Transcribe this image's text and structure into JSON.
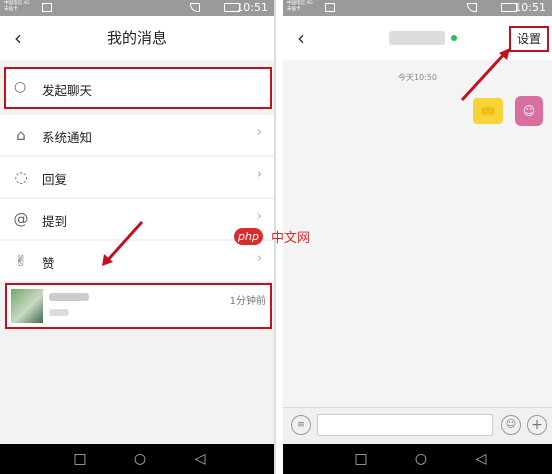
{
  "left_screen": {
    "status": {
      "carrier": "中国电信 4G\n未插卡",
      "time": "10:51"
    },
    "header": {
      "back_icon": "back-chevron-icon",
      "title": "我的消息"
    },
    "start_chat": {
      "icon": "chat-bubble-icon",
      "label": "发起聊天"
    },
    "menu_items": [
      {
        "icon": "bell-icon",
        "label": "系统通知"
      },
      {
        "icon": "comment-icon",
        "label": "回复"
      },
      {
        "icon": "at-icon",
        "label": "提到"
      },
      {
        "icon": "thumbs-up-icon",
        "label": "赞"
      }
    ],
    "contact": {
      "time": "1分钟前"
    },
    "nav": {
      "square": "□",
      "circle": "○",
      "back": "◁"
    }
  },
  "right_screen": {
    "status": {
      "carrier": "中国电信 4G\n未插卡",
      "time": "10:51"
    },
    "header": {
      "back_icon": "back-chevron-icon",
      "settings_label": "设置"
    },
    "timestamp": "今天10:50",
    "input": {
      "voice_icon": "voice-icon",
      "emoji_icon": "emoji-icon",
      "plus_icon": "plus-icon"
    },
    "nav": {
      "square": "□",
      "circle": "○",
      "back": "◁"
    }
  },
  "watermark": {
    "logo": "php",
    "text": "中文网"
  },
  "colors": {
    "highlight_red": "#c0121e",
    "online_green": "#2bc04a",
    "bubble_yellow": "#f6d43a"
  }
}
